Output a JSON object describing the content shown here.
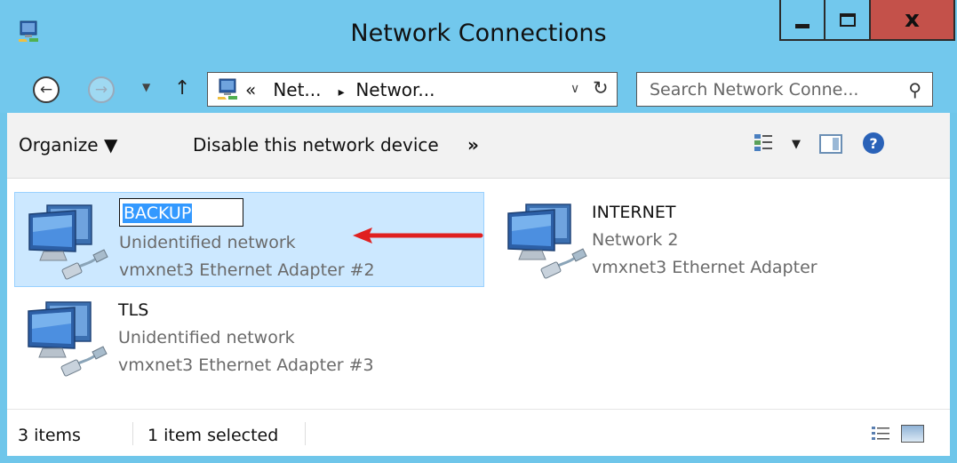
{
  "window": {
    "title": "Network Connections",
    "controls": {
      "minimize": "minimize",
      "maximize": "maximize",
      "close": "x"
    }
  },
  "address_bar": {
    "overflow_marker": "«",
    "crumb_1": "Net...",
    "crumb_separator": "▸",
    "crumb_2": "Networ...",
    "dropdown": "∨",
    "refresh": "↻"
  },
  "search": {
    "placeholder": "Search Network Conne..."
  },
  "nav": {
    "back": "←",
    "forward": "→",
    "history": "▼",
    "up": "↑"
  },
  "command_bar": {
    "organize": "Organize ▼",
    "disable": "Disable this network device",
    "more": "»",
    "view_dropdown": "▼",
    "help": "?"
  },
  "connections": [
    {
      "name": "BACKUP",
      "status": "Unidentified network",
      "adapter": "vmxnet3 Ethernet Adapter #2",
      "selected": true,
      "renaming": true
    },
    {
      "name": "INTERNET",
      "status": "Network  2",
      "adapter": "vmxnet3 Ethernet Adapter",
      "selected": false,
      "renaming": false
    },
    {
      "name": "TLS",
      "status": "Unidentified network",
      "adapter": "vmxnet3 Ethernet Adapter #3",
      "selected": false,
      "renaming": false
    }
  ],
  "status_bar": {
    "item_count": "3 items",
    "selection": "1 item selected"
  },
  "colors": {
    "window_frame": "#72c8ed",
    "close_button": "#c4514a",
    "selection_bg": "#cce8ff",
    "selection_border": "#99d1ff",
    "annotation_arrow": "#e02020"
  }
}
